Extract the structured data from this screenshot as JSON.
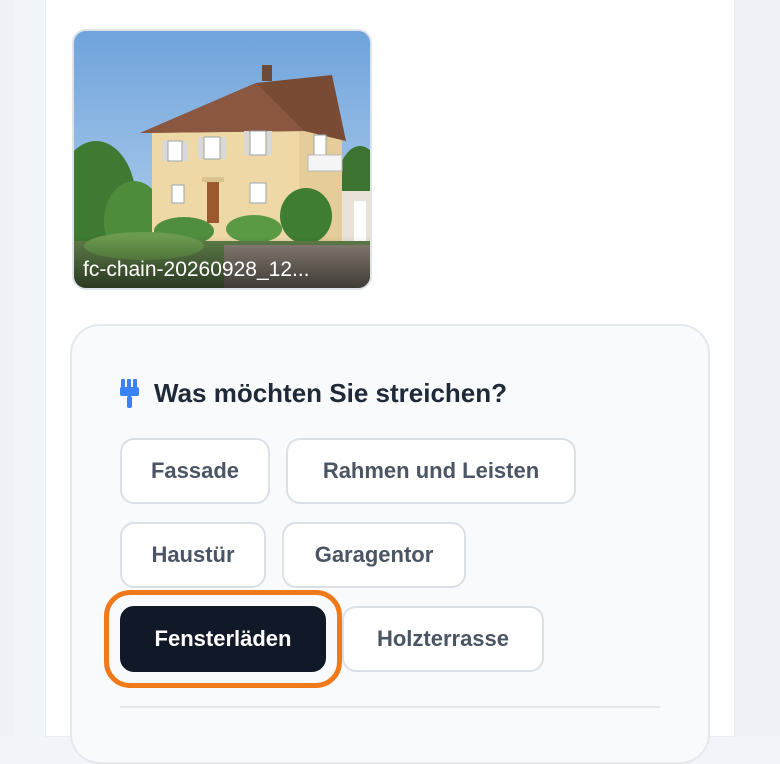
{
  "upload": {
    "filename": "fc-chain-20260928_12..."
  },
  "question": {
    "icon": "paint-brush-icon",
    "title": "Was möchten Sie streichen?"
  },
  "options": [
    {
      "label": "Fassade",
      "selected": false
    },
    {
      "label": "Rahmen und Leisten",
      "selected": false
    },
    {
      "label": "Haustür",
      "selected": false
    },
    {
      "label": "Garagentor",
      "selected": false
    },
    {
      "label": "Fensterläden",
      "selected": true
    },
    {
      "label": "Holzterrasse",
      "selected": false
    }
  ],
  "colors": {
    "accent": "#f07a1a",
    "selected_bg": "#111827",
    "icon": "#3b82f6"
  }
}
